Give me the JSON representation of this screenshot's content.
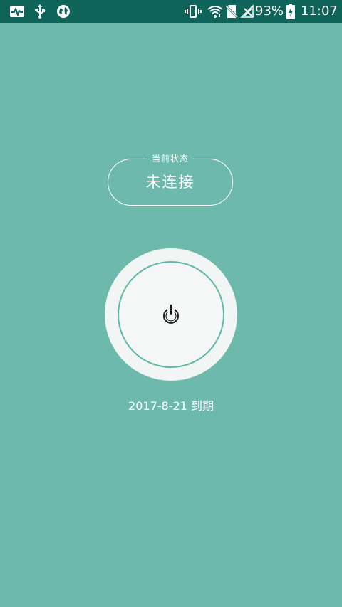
{
  "status_bar": {
    "icons_left": [
      "activity-monitor-icon",
      "usb-icon",
      "globe-icon"
    ],
    "icons_right": [
      "vibrate-icon",
      "wifi-icon",
      "no-sim-icon",
      "no-signal-icon",
      "battery-charging-icon"
    ],
    "battery_percent": "93%",
    "time": "11:07"
  },
  "connection": {
    "status_label": "当前状态",
    "status_value": "未连接"
  },
  "power_button": {
    "icon": "power-icon"
  },
  "expiry_text": "2017-8-21 到期",
  "colors": {
    "background": "#6dbaad",
    "status_bar": "#0f645a",
    "button_face": "#f1f5f4",
    "button_ring": "#5fb7a8"
  }
}
